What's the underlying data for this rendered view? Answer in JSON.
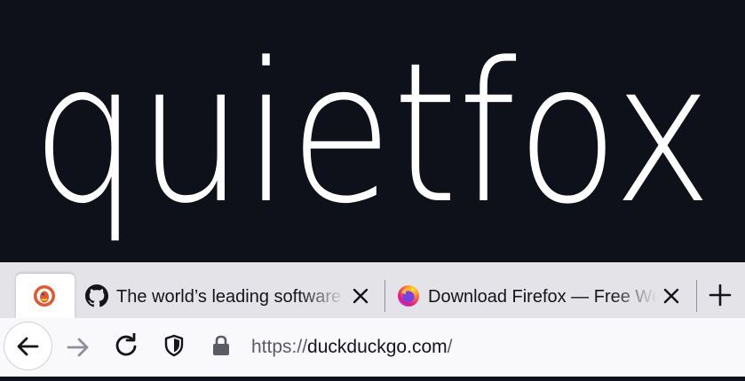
{
  "banner": {
    "wordmark": "quietfox",
    "background_color": "#0f111a",
    "text_color": "#ffffff"
  },
  "tabs": [
    {
      "title": "",
      "favicon": "duckduckgo-icon",
      "active": true
    },
    {
      "title": "The world’s leading software de",
      "favicon": "github-icon",
      "active": false
    },
    {
      "title": "Download Firefox — Free Web",
      "favicon": "firefox-icon",
      "active": false
    }
  ],
  "toolbar": {
    "back": "back-arrow-icon",
    "forward": "forward-arrow-icon",
    "reload": "reload-icon",
    "tracking_protection": "shield-icon",
    "security": "lock-icon",
    "new_tab": "plus-icon"
  },
  "urlbar": {
    "scheme": "https://",
    "host": "duckduckgo.com",
    "tail": "/"
  },
  "colors": {
    "tabbar": "#e4e4e8",
    "navbar": "#f9f9fb",
    "active_tab": "#ffffff",
    "icon": "#15141a",
    "disabled_icon": "#8f8f9d"
  }
}
